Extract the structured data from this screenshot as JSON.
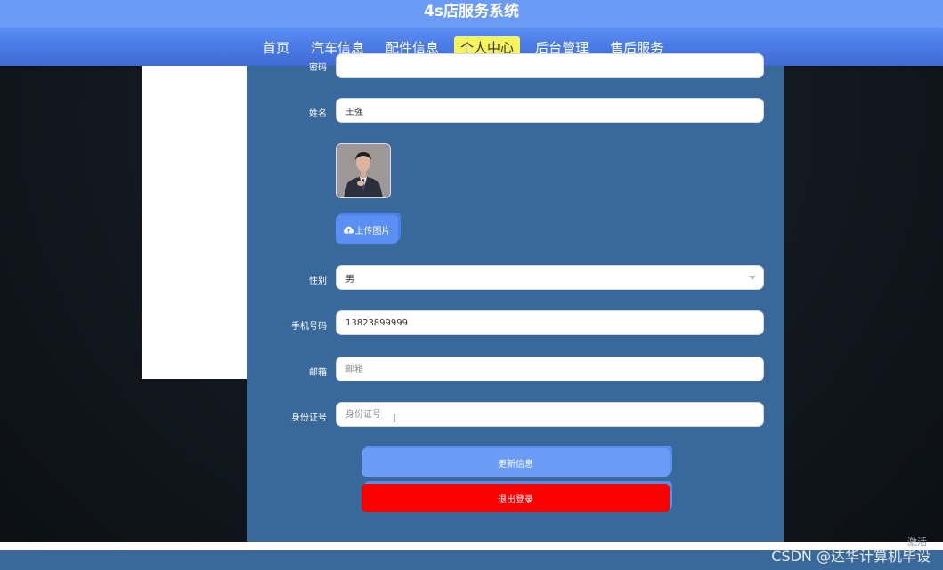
{
  "header": {
    "title": "4s店服务系统"
  },
  "nav": {
    "items": [
      {
        "label": "首页"
      },
      {
        "label": "汽车信息"
      },
      {
        "label": "配件信息"
      },
      {
        "label": "个人中心",
        "active": true
      },
      {
        "label": "后台管理"
      },
      {
        "label": "售后服务"
      }
    ],
    "active_color": "#f7f35a"
  },
  "form": {
    "password": {
      "label": "密码",
      "value": ""
    },
    "name": {
      "label": "姓名",
      "value": "王强"
    },
    "upload": {
      "label": "上传图片",
      "icon": "cloud-upload-icon"
    },
    "gender": {
      "label": "性别",
      "value": "男"
    },
    "phone": {
      "label": "手机号码",
      "value": "13823899999"
    },
    "email": {
      "label": "邮箱",
      "placeholder": "邮箱"
    },
    "idcard": {
      "label": "身份证号",
      "placeholder": "身份证号"
    },
    "update_label": "更新信息",
    "logout_label": "退出登录"
  },
  "colors": {
    "header": "#6a9cf5",
    "panel": "#39699b",
    "primary_button": "#6a9cf5",
    "danger_button": "#fc0000"
  },
  "watermark": "CSDN @达华计算机毕设",
  "activate_text": "激活"
}
